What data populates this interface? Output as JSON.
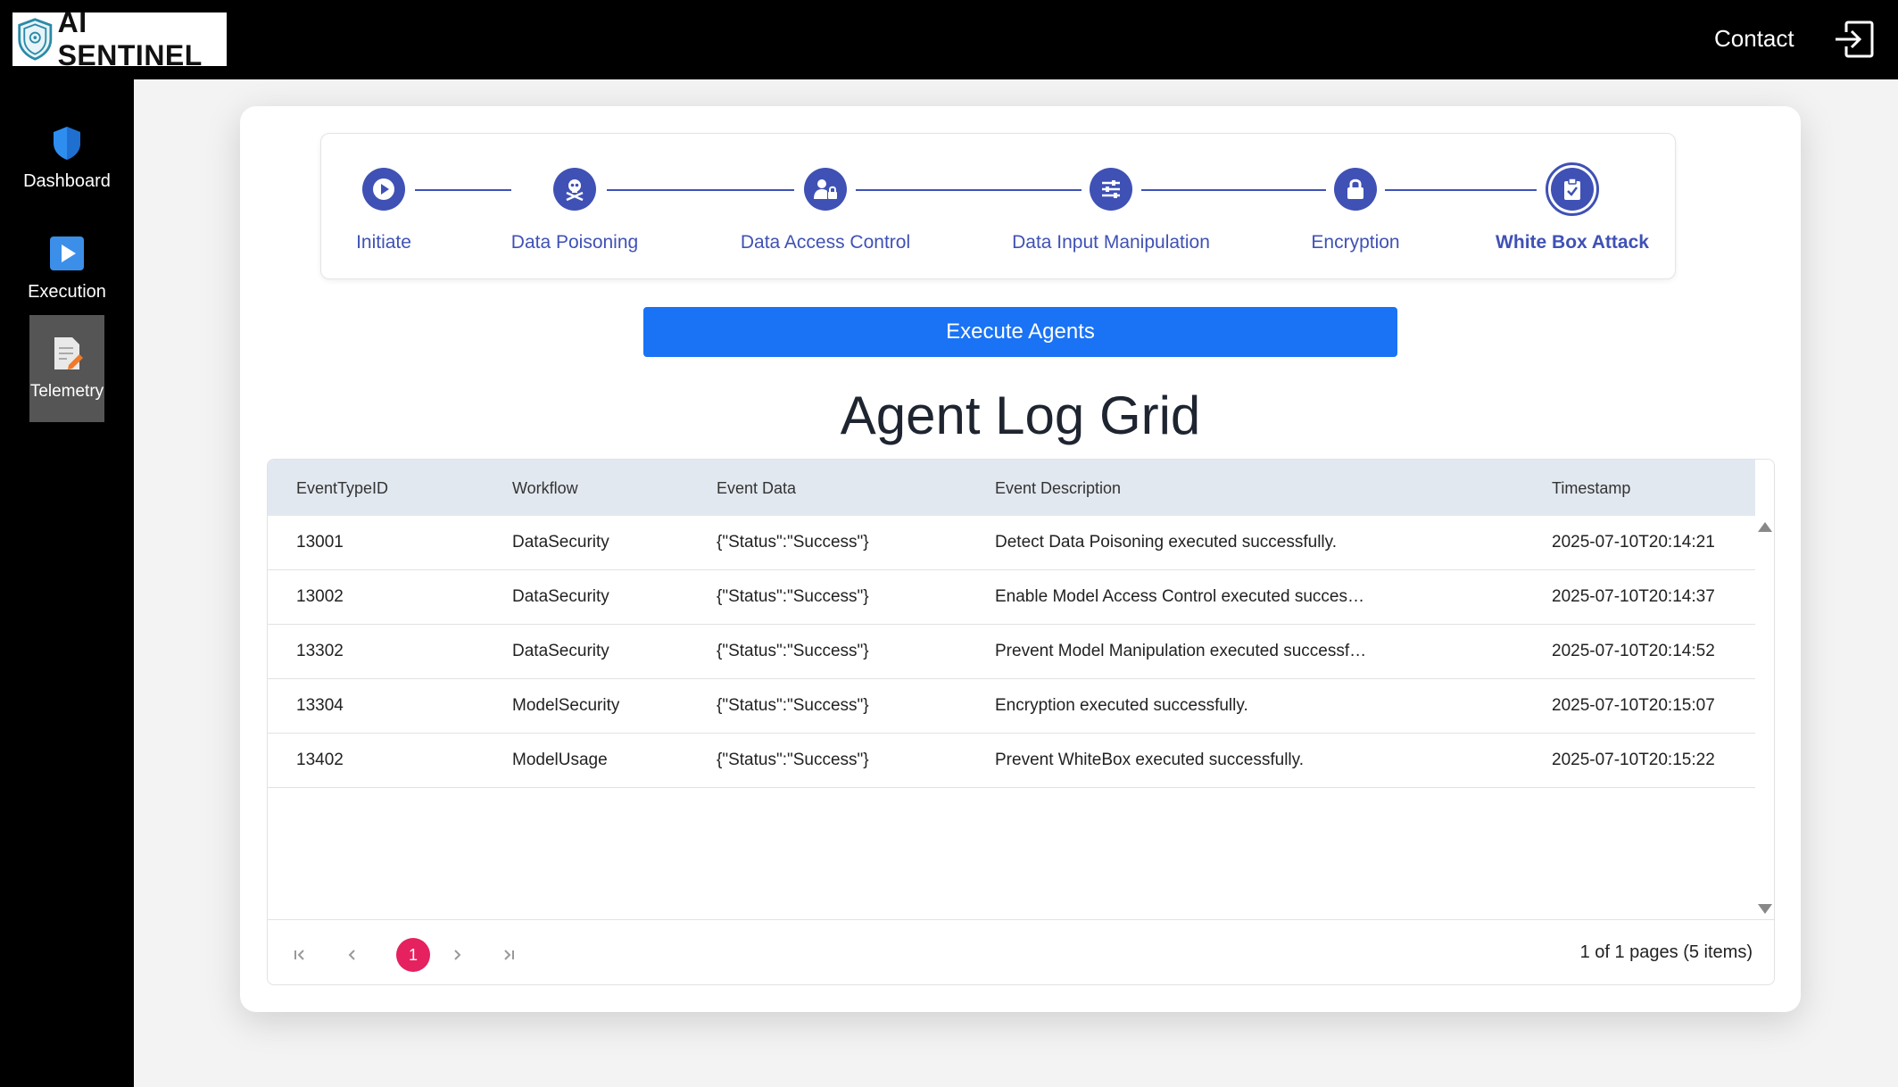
{
  "header": {
    "logo_text": "AI SENTINEL",
    "contact_label": "Contact",
    "logout_icon": "logout-icon"
  },
  "sidebar": {
    "items": [
      {
        "label": "Dashboard",
        "icon": "shield-icon"
      },
      {
        "label": "Execution",
        "icon": "play-icon"
      },
      {
        "label": "Telemetry",
        "icon": "document-edit-icon",
        "active": true
      }
    ]
  },
  "stepper": {
    "steps": [
      {
        "label": "Initiate",
        "icon": "play-icon"
      },
      {
        "label": "Data Poisoning",
        "icon": "skull-crossbones-icon"
      },
      {
        "label": "Data Access Control",
        "icon": "user-lock-icon"
      },
      {
        "label": "Data Input Manipulation",
        "icon": "sliders-icon"
      },
      {
        "label": "Encryption",
        "icon": "lock-icon"
      },
      {
        "label": "White Box Attack",
        "icon": "clipboard-check-icon",
        "current": true
      }
    ],
    "accent_color": "#3f51b5"
  },
  "execute_button_label": "Execute Agents",
  "grid": {
    "title": "Agent Log Grid",
    "columns": [
      "EventTypeID",
      "Workflow",
      "Event Data",
      "Event Description",
      "Timestamp"
    ],
    "rows": [
      [
        "13001",
        "DataSecurity",
        "{\"Status\":\"Success\"}",
        "Detect Data Poisoning executed successfully.",
        "2025-07-10T20:14:21"
      ],
      [
        "13002",
        "DataSecurity",
        "{\"Status\":\"Success\"}",
        "Enable Model Access Control executed successfully.",
        "2025-07-10T20:14:37"
      ],
      [
        "13302",
        "DataSecurity",
        "{\"Status\":\"Success\"}",
        "Prevent Model Manipulation executed successfully - Integrity Ch...",
        "2025-07-10T20:14:52"
      ],
      [
        "13304",
        "ModelSecurity",
        "{\"Status\":\"Success\"}",
        "Encryption executed successfully.",
        "2025-07-10T20:15:07"
      ],
      [
        "13402",
        "ModelUsage",
        "{\"Status\":\"Success\"}",
        "Prevent WhiteBox executed successfully.",
        "2025-07-10T20:15:22"
      ]
    ],
    "pager": {
      "current_page": "1",
      "info": "1 of 1 pages (5 items)",
      "active_color": "#e5215f"
    }
  }
}
